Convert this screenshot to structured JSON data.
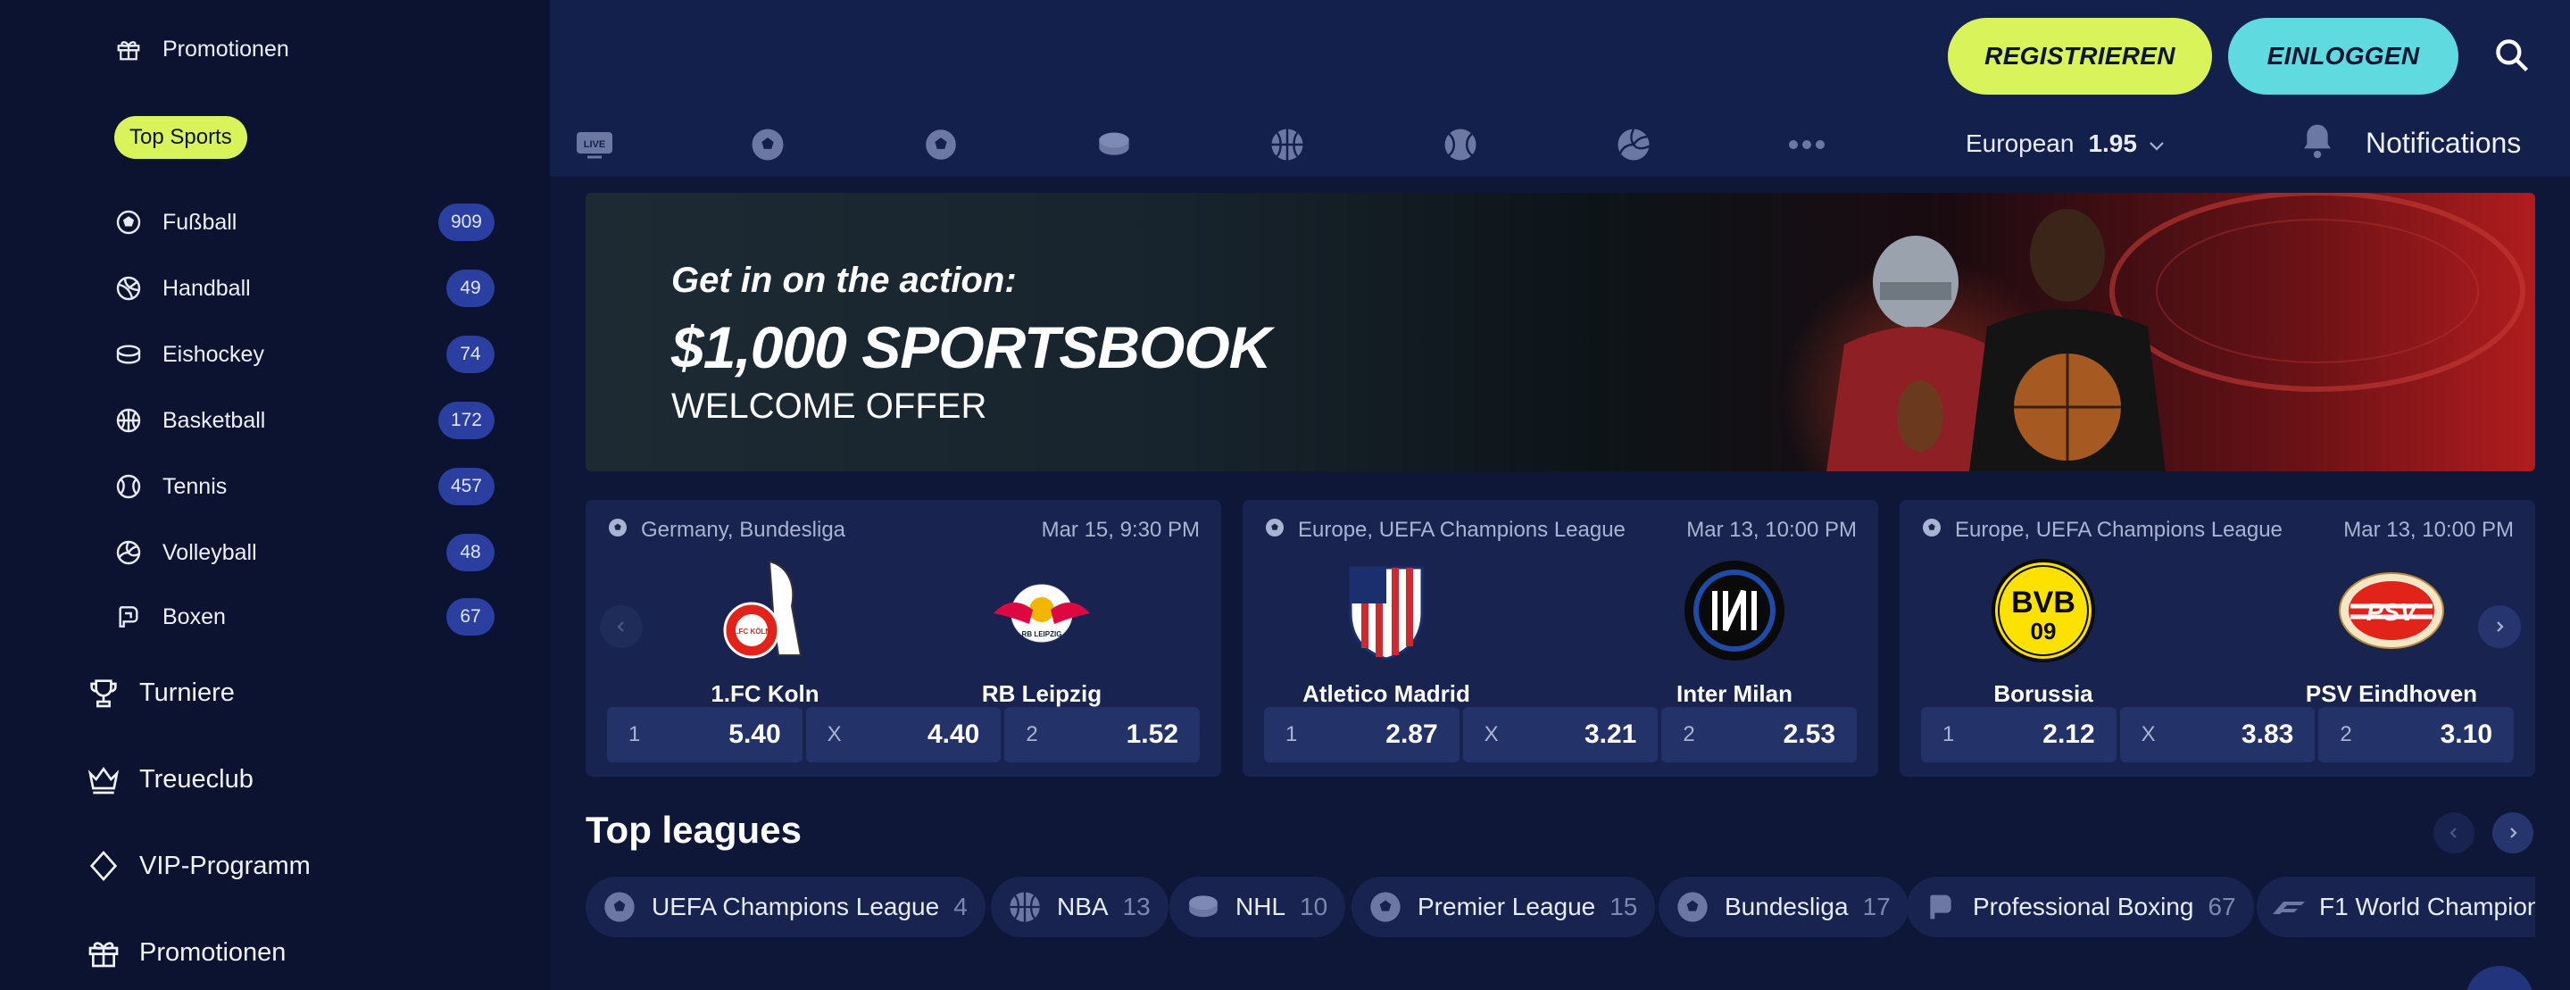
{
  "sidebar": {
    "promo_top": "Promotionen",
    "top_sports": "Top Sports",
    "sports": [
      {
        "label": "Fußball",
        "count": "909",
        "icon": "soccer-ball-icon"
      },
      {
        "label": "Handball",
        "count": "49",
        "icon": "handball-icon"
      },
      {
        "label": "Eishockey",
        "count": "74",
        "icon": "hockey-puck-icon"
      },
      {
        "label": "Basketball",
        "count": "172",
        "icon": "basketball-icon"
      },
      {
        "label": "Tennis",
        "count": "457",
        "icon": "tennis-ball-icon"
      },
      {
        "label": "Volleyball",
        "count": "48",
        "icon": "volleyball-icon"
      },
      {
        "label": "Boxen",
        "count": "67",
        "icon": "boxing-glove-icon"
      }
    ],
    "main": [
      {
        "label": "Turniere",
        "icon": "trophy-icon"
      },
      {
        "label": "Treueclub",
        "icon": "crown-icon"
      },
      {
        "label": "VIP-Programm",
        "icon": "diamond-icon"
      },
      {
        "label": "Promotionen",
        "icon": "gift-icon"
      }
    ]
  },
  "header": {
    "register": "REGISTRIEREN",
    "login": "EINLOGGEN",
    "live_badge": "LIVE",
    "odds_format": "European",
    "odds_value": "1.95",
    "notifications": "Notifications"
  },
  "banner": {
    "line1": "Get in on the action:",
    "line2": "$1,000 SPORTSBOOK",
    "line3": "WELCOME OFFER"
  },
  "matches": [
    {
      "league": "Germany, Bundesliga",
      "time": "Mar 15, 9:30 PM",
      "home": "1.FC Koln",
      "away": "RB Leipzig",
      "odds": [
        {
          "k": "1",
          "v": "5.40"
        },
        {
          "k": "X",
          "v": "4.40"
        },
        {
          "k": "2",
          "v": "1.52"
        }
      ]
    },
    {
      "league": "Europe, UEFA Champions League",
      "time": "Mar 13, 10:00 PM",
      "home": "Atletico Madrid",
      "away": "Inter Milan",
      "odds": [
        {
          "k": "1",
          "v": "2.87"
        },
        {
          "k": "X",
          "v": "3.21"
        },
        {
          "k": "2",
          "v": "2.53"
        }
      ]
    },
    {
      "league": "Europe, UEFA Champions League",
      "time": "Mar 13, 10:00 PM",
      "home": "Borussia Dortmund",
      "away": "PSV Eindhoven",
      "odds": [
        {
          "k": "1",
          "v": "2.12"
        },
        {
          "k": "X",
          "v": "3.83"
        },
        {
          "k": "2",
          "v": "3.10"
        }
      ]
    }
  ],
  "logos": {
    "koln": "1.FC KÖLN",
    "leipzig": "RB LEIPZIG",
    "bvb": "BVB",
    "bvb_year": "09",
    "psv": "PSV"
  },
  "top_leagues": {
    "title": "Top leagues",
    "items": [
      {
        "label": "UEFA Champions League",
        "count": "4"
      },
      {
        "label": "NBA",
        "count": "13"
      },
      {
        "label": "NHL",
        "count": "10"
      },
      {
        "label": "Premier League",
        "count": "15"
      },
      {
        "label": "Bundesliga",
        "count": "17"
      },
      {
        "label": "Professional Boxing",
        "count": "67"
      },
      {
        "label": "F1 World Champion",
        "count": ""
      }
    ]
  },
  "colors": {
    "accent_lime": "#d8f45a",
    "accent_cyan": "#5fdbe0",
    "badge_blue": "#2a3fa0",
    "bg": "#0f1738"
  }
}
